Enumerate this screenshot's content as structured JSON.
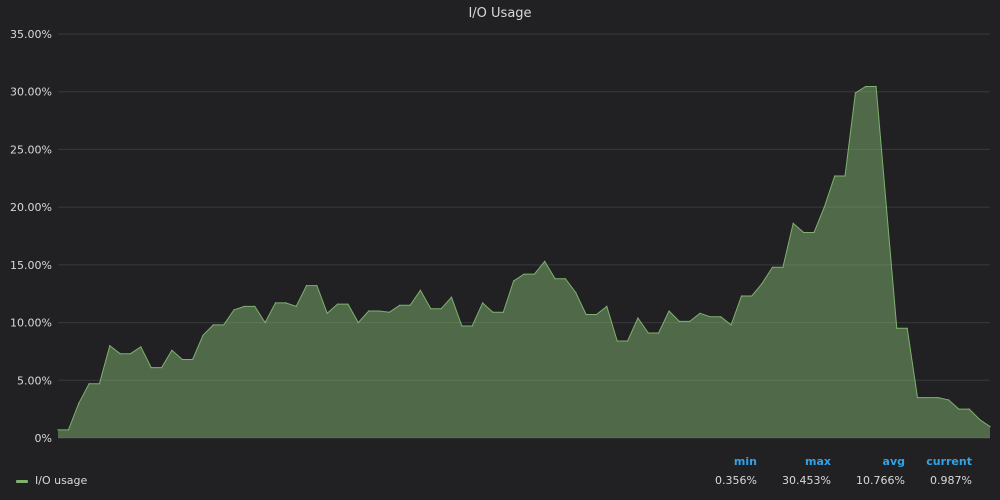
{
  "colors": {
    "background": "#212124",
    "grid": "#3a3a3d",
    "line": "#7eb26d",
    "fill": "#7eb26d",
    "legend_header": "#33a2e5",
    "text": "#d8d9da"
  },
  "chart_data": {
    "type": "area",
    "title": "I/O Usage",
    "xlabel": "",
    "ylabel": "",
    "ylim": [
      0,
      35
    ],
    "y_tick_labels": [
      "0%",
      "5.00%",
      "10.00%",
      "15.00%",
      "20.00%",
      "25.00%",
      "30.00%",
      "35.00%"
    ],
    "y_ticks": [
      0,
      5,
      10,
      15,
      20,
      25,
      30,
      35
    ],
    "grid": true,
    "legend_position": "bottom",
    "series": [
      {
        "name": "I/O usage",
        "values": [
          0.7,
          0.7,
          3.0,
          4.7,
          4.7,
          8.0,
          7.3,
          7.3,
          7.9,
          6.1,
          6.1,
          7.6,
          6.8,
          6.8,
          8.9,
          9.8,
          9.8,
          11.1,
          11.4,
          11.4,
          10.0,
          11.7,
          11.7,
          11.4,
          13.2,
          13.2,
          10.8,
          11.6,
          11.6,
          10.0,
          11.0,
          11.0,
          10.9,
          11.5,
          11.5,
          12.8,
          11.2,
          11.2,
          12.2,
          9.7,
          9.7,
          11.7,
          10.9,
          10.9,
          13.6,
          14.2,
          14.2,
          15.3,
          13.8,
          13.8,
          12.6,
          10.7,
          10.7,
          11.4,
          8.4,
          8.4,
          10.4,
          9.1,
          9.1,
          11.0,
          10.1,
          10.1,
          10.8,
          10.5,
          10.5,
          9.8,
          12.3,
          12.3,
          13.4,
          14.8,
          14.8,
          18.6,
          17.8,
          17.8,
          20.0,
          22.7,
          22.7,
          29.9,
          30.45,
          30.45,
          20.0,
          9.5,
          9.5,
          3.5,
          3.5,
          3.5,
          3.3,
          2.5,
          2.5,
          1.6,
          0.987
        ]
      }
    ]
  },
  "legend": {
    "headers": {
      "min": "min",
      "max": "max",
      "avg": "avg",
      "current": "current"
    },
    "series_name": "I/O usage",
    "min": "0.356%",
    "max": "30.453%",
    "avg": "10.766%",
    "current": "0.987%"
  }
}
